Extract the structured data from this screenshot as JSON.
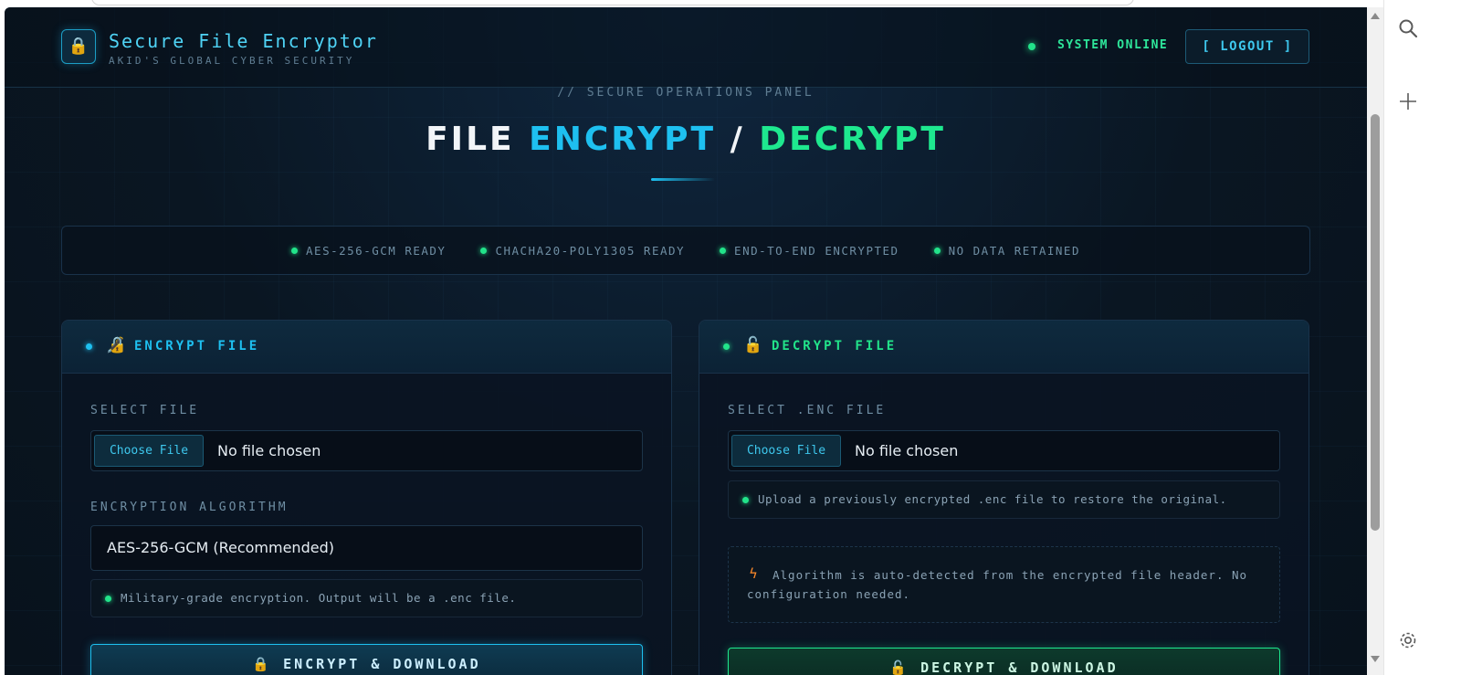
{
  "header": {
    "title": "Secure File Encryptor",
    "subtitle": "AKID'S GLOBAL CYBER SECURITY",
    "status": "SYSTEM ONLINE",
    "logout_label": "[ LOGOUT ]",
    "logo_icon": "lock-icon"
  },
  "hero": {
    "kicker": "// SECURE OPERATIONS PANEL",
    "title_part1": "FILE ",
    "title_part2": "ENCRYPT",
    "title_part3": " / ",
    "title_part4": "DECRYPT"
  },
  "status_strip": [
    "AES-256-GCM READY",
    "CHACHA20-POLY1305 READY",
    "END-TO-END ENCRYPTED",
    "NO DATA RETAINED"
  ],
  "encrypt_panel": {
    "title": "ENCRYPT FILE",
    "file_label": "SELECT FILE",
    "choose_label": "Choose File",
    "file_status": "No file chosen",
    "algo_label": "ENCRYPTION ALGORITHM",
    "algo_selected": "AES-256-GCM (Recommended)",
    "hint": "Military-grade encryption. Output will be a .enc file.",
    "action_label": "🔒 ENCRYPT & DOWNLOAD"
  },
  "decrypt_panel": {
    "title": "DECRYPT FILE",
    "file_label": "SELECT .ENC FILE",
    "choose_label": "Choose File",
    "file_status": "No file chosen",
    "hint": "Upload a previously encrypted .enc file to restore the original.",
    "note": "Algorithm is auto-detected from the encrypted file header. No configuration needed.",
    "action_label": "🔓 DECRYPT & DOWNLOAD"
  },
  "colors": {
    "accent_cyan": "#1ec0f0",
    "accent_green": "#22e38a",
    "background": "#0a1622",
    "warning": "#ff8a2a"
  }
}
